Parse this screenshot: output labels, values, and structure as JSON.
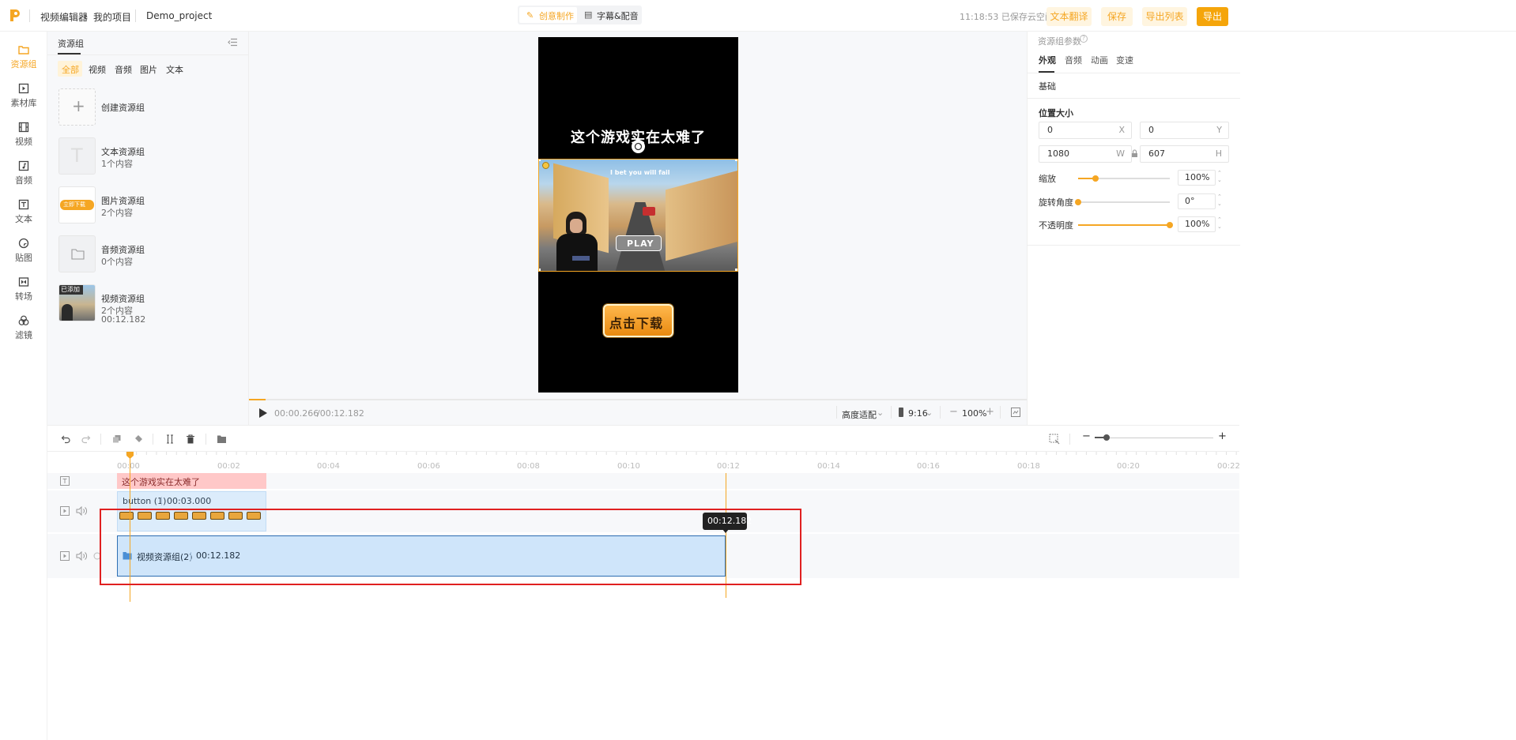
{
  "topbar": {
    "breadcrumb": [
      "视频编辑器",
      "我的项目"
    ],
    "project_name": "Demo_project",
    "mode_tabs": [
      {
        "label": "创意制作",
        "active": true
      },
      {
        "label": "字幕&配音",
        "active": false
      }
    ],
    "save_status": "11:18:53 已保存云空间",
    "buttons": {
      "translate": "文本翻译",
      "save": "保存",
      "export_list": "导出列表",
      "export": "导出"
    }
  },
  "rail": [
    {
      "label": "资源组",
      "icon": "folder-icon",
      "active": true
    },
    {
      "label": "素材库",
      "icon": "play-square-icon",
      "active": false
    },
    {
      "label": "视频",
      "icon": "film-icon",
      "active": false
    },
    {
      "label": "音频",
      "icon": "music-icon",
      "active": false
    },
    {
      "label": "文本",
      "icon": "text-icon",
      "active": false
    },
    {
      "label": "贴图",
      "icon": "sticker-icon",
      "active": false
    },
    {
      "label": "转场",
      "icon": "transition-icon",
      "active": false
    },
    {
      "label": "滤镜",
      "icon": "filter-icon",
      "active": false
    }
  ],
  "resources": {
    "title": "资源组",
    "filters": [
      "全部",
      "视频",
      "音频",
      "图片",
      "文本"
    ],
    "active_filter": "全部",
    "create_label": "创建资源组",
    "items": [
      {
        "title": "文本资源组",
        "count": "1个内容",
        "duration": "",
        "thumb_text": "T"
      },
      {
        "title": "图片资源组",
        "count": "2个内容",
        "duration": "",
        "thumb_text": "立即下载"
      },
      {
        "title": "音频资源组",
        "count": "0个内容",
        "duration": "",
        "thumb_text": ""
      },
      {
        "title": "视频资源组",
        "count": "2个内容",
        "duration": "00:12.182",
        "thumb_text": "已添加"
      }
    ]
  },
  "preview": {
    "headline": "这个游戏实在太难了",
    "game_banner": "I bet you will fail",
    "play_label": "PLAY",
    "download_button": "点击下载",
    "time_current": "00:00.266",
    "time_total": "/00:12.182",
    "fit_label": "高度适配",
    "ratio": "9:16",
    "zoom": "100%",
    "minus": "−",
    "plus": "+"
  },
  "props": {
    "title": "资源组参数",
    "tabs": [
      "外观",
      "音频",
      "动画",
      "变速"
    ],
    "active_tab": "外观",
    "section_basic": "基础",
    "section_pos": "位置大小",
    "x": "0",
    "x_unit": "X",
    "y": "0",
    "y_unit": "Y",
    "w": "1080",
    "w_unit": "W",
    "h": "607",
    "h_unit": "H",
    "rows": [
      {
        "label": "缩放",
        "value": "100%",
        "level": 0.19
      },
      {
        "label": "旋转角度",
        "value": "0°",
        "level": 0.0
      },
      {
        "label": "不透明度",
        "value": "100%",
        "level": 1.0
      }
    ]
  },
  "timeline": {
    "ticks": [
      "00:00",
      "00:02",
      "00:04",
      "00:06",
      "00:08",
      "00:10",
      "00:12",
      "00:14",
      "00:16",
      "00:18",
      "00:20",
      "00:22"
    ],
    "text_clip": "这个游戏实在太难了",
    "button_clip_name": "button (1)",
    "button_clip_duration": "00:03.000",
    "thumb_label": "点击下载",
    "video_group_name": "视频资源组(2)",
    "video_group_duration": "00:12.182",
    "tooltip": "00:12.182"
  },
  "colors": {
    "accent": "#f5a623",
    "selection": "#e02020",
    "clip_blue": "#cfe5fa"
  }
}
